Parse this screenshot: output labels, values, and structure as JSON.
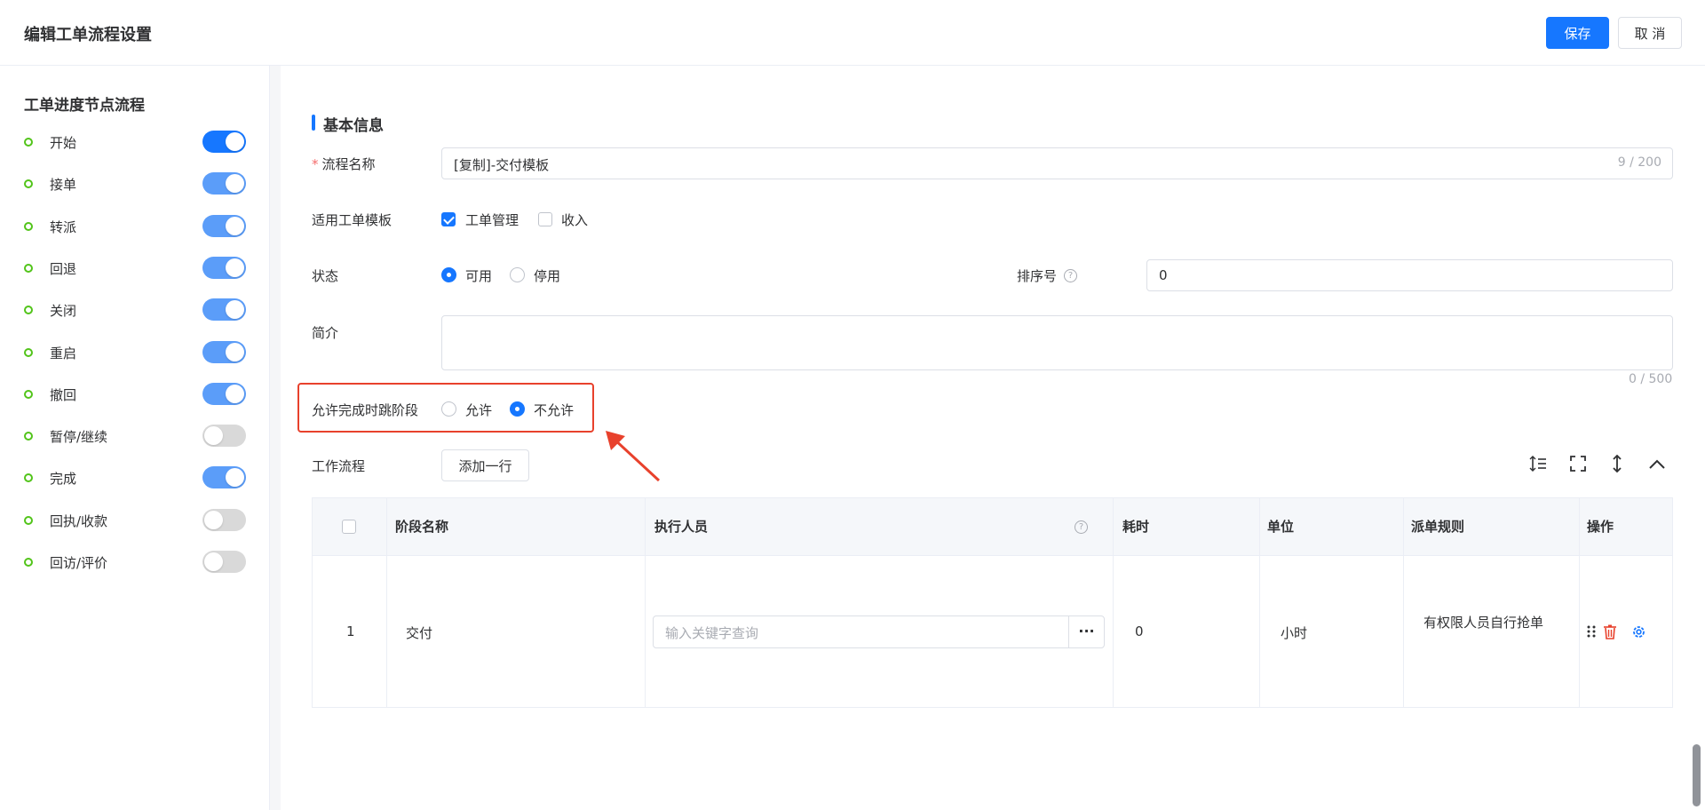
{
  "header": {
    "title": "编辑工单流程设置",
    "save_label": "保存",
    "cancel_label": "取 消"
  },
  "sidebar": {
    "title": "工单进度节点流程",
    "nodes": [
      {
        "label": "开始",
        "enabled": true
      },
      {
        "label": "接单",
        "enabled": true
      },
      {
        "label": "转派",
        "enabled": true
      },
      {
        "label": "回退",
        "enabled": true
      },
      {
        "label": "关闭",
        "enabled": true
      },
      {
        "label": "重启",
        "enabled": true
      },
      {
        "label": "撤回",
        "enabled": true
      },
      {
        "label": "暂停/继续",
        "enabled": false
      },
      {
        "label": "完成",
        "enabled": true
      },
      {
        "label": "回执/收款",
        "enabled": false
      },
      {
        "label": "回访/评价",
        "enabled": false
      }
    ]
  },
  "form": {
    "section_title": "基本信息",
    "name": {
      "label": "流程名称",
      "required_mark": "*",
      "value": "[复制]-交付模板",
      "count": "9 / 200"
    },
    "template": {
      "label": "适用工单模板",
      "options": [
        {
          "label": "工单管理",
          "checked": true
        },
        {
          "label": "收入",
          "checked": false
        }
      ]
    },
    "status": {
      "label": "状态",
      "options": [
        {
          "label": "可用",
          "checked": true
        },
        {
          "label": "停用",
          "checked": false
        }
      ]
    },
    "sort": {
      "label": "排序号",
      "help": "?",
      "value": "0"
    },
    "intro": {
      "label": "简介",
      "value": "",
      "count": "0 / 500"
    },
    "skip": {
      "label": "允许完成时跳阶段",
      "options": [
        {
          "label": "允许",
          "checked": false
        },
        {
          "label": "不允许",
          "checked": true
        }
      ]
    },
    "workflow": {
      "label": "工作流程",
      "add_row_label": "添加一行"
    }
  },
  "table": {
    "columns": [
      "阶段名称",
      "执行人员",
      "耗时",
      "单位",
      "派单规则",
      "操作"
    ],
    "help": "?",
    "rows": [
      {
        "index": "1",
        "stage": "交付",
        "executor_placeholder": "输入关键字查询",
        "more": "···",
        "duration": "0",
        "unit": "小时",
        "rule": "有权限人员自行抢单"
      }
    ]
  }
}
